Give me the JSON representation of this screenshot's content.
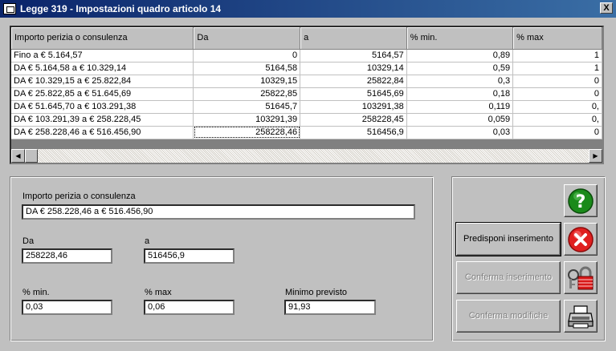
{
  "window": {
    "title": "Legge 319 - Impostazioni quadro articolo 14",
    "close_label": "X"
  },
  "grid": {
    "headers": [
      "Importo perizia o consulenza",
      "Da",
      "a",
      "% min.",
      "% max"
    ],
    "rows": [
      [
        "Fino a € 5.164,57",
        "0",
        "5164,57",
        "0,89",
        "1"
      ],
      [
        "DA € 5.164,58 a € 10.329,14",
        "5164,58",
        "10329,14",
        "0,59",
        "1"
      ],
      [
        "DA € 10.329,15 a € 25.822,84",
        "10329,15",
        "25822,84",
        "0,3",
        "0"
      ],
      [
        "DA € 25.822,85 a € 51.645,69",
        "25822,85",
        "51645,69",
        "0,18",
        "0"
      ],
      [
        "DA € 51.645,70 a € 103.291,38",
        "51645,7",
        "103291,38",
        "0,119",
        "0,"
      ],
      [
        "DA € 103.291,39 a € 258.228,45",
        "103291,39",
        "258228,45",
        "0,059",
        "0,"
      ],
      [
        "DA € 258.228,46 a € 516.456,90",
        "258228,46",
        "516456,9",
        "0,03",
        "0"
      ]
    ]
  },
  "form": {
    "importo_label": "Importo perizia o consulenza",
    "importo_value": "DA € 258.228,46 a € 516.456,90",
    "da_label": "Da",
    "da_value": "258228,46",
    "a_label": "a",
    "a_value": "516456,9",
    "min_label": "% min.",
    "min_value": "0,03",
    "max_label": "% max",
    "max_value": "0,06",
    "minimo_label": "Minimo previsto",
    "minimo_value": "91,93"
  },
  "buttons": {
    "predisponi": "Predisponi inserimento",
    "conferma_ins": "Conferma inserimento",
    "conferma_mod": "Conferma modifiche"
  },
  "icons": {
    "help": "question-mark-icon",
    "cancel": "red-x-icon",
    "lock": "lock-icon",
    "print": "printer-icon"
  },
  "colors": {
    "help_green": "#1a8a1a",
    "cancel_red": "#e02020",
    "titlebar": "#0a246a"
  }
}
